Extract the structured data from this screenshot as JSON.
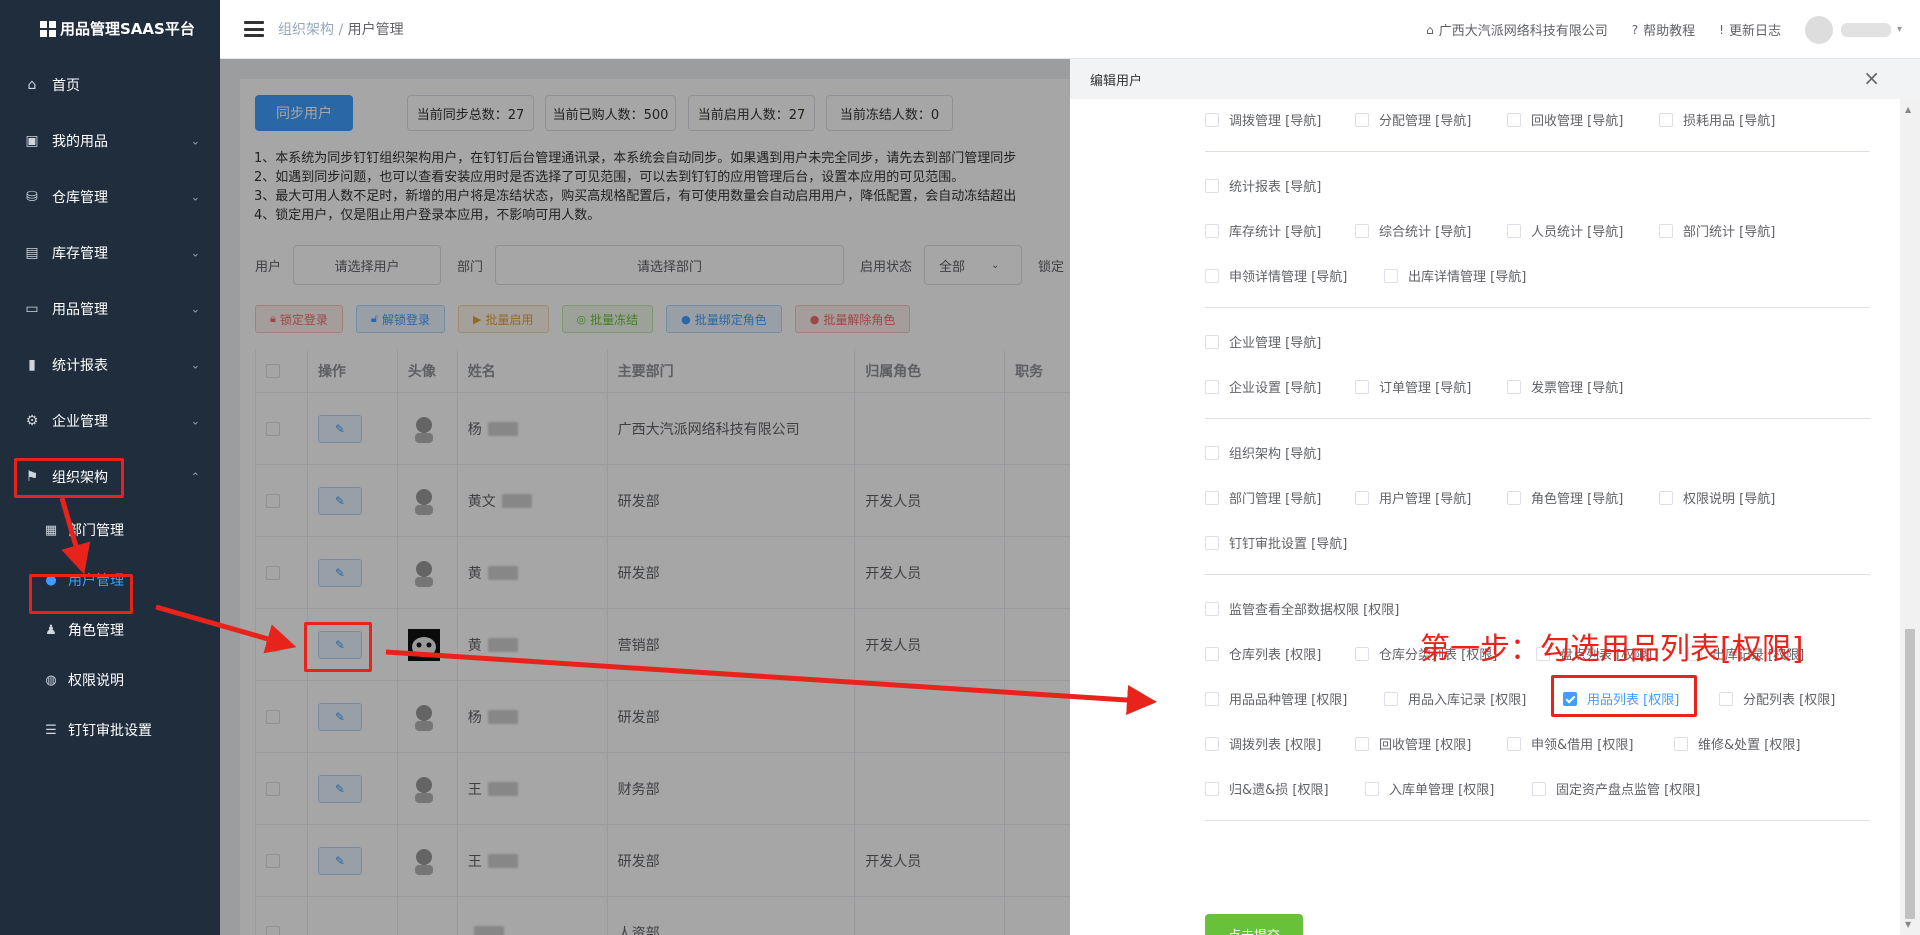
{
  "brand": {
    "title": "用品管理SAAS平台"
  },
  "sidebar": {
    "items": [
      {
        "label": "首页",
        "icon": "home-icon"
      },
      {
        "label": "我的用品",
        "icon": "bag-icon"
      },
      {
        "label": "仓库管理",
        "icon": "database-icon"
      },
      {
        "label": "库存管理",
        "icon": "box-icon"
      },
      {
        "label": "用品管理",
        "icon": "tray-icon"
      },
      {
        "label": "统计报表",
        "icon": "chart-icon"
      },
      {
        "label": "企业管理",
        "icon": "gear-icon"
      },
      {
        "label": "组织架构",
        "icon": "flag-icon"
      }
    ],
    "subitems": [
      {
        "label": "部门管理",
        "icon": "grid-icon"
      },
      {
        "label": "用户管理",
        "icon": "user-icon"
      },
      {
        "label": "角色管理",
        "icon": "role-icon"
      },
      {
        "label": "权限说明",
        "icon": "shield-icon"
      },
      {
        "label": "钉钉审批设置",
        "icon": "sliders-icon"
      }
    ]
  },
  "header": {
    "breadcrumb_parent": "组织架构",
    "breadcrumb_sep": "/",
    "breadcrumb_current": "用户管理",
    "company": "广西大汽派网络科技有限公司",
    "help": "帮助教程",
    "changelog": "更新日志"
  },
  "main": {
    "sync_button": "同步用户",
    "stats": [
      "当前同步总数：27",
      "当前已购人数：500",
      "当前启用人数：27",
      "当前冻结人数：0"
    ],
    "notes": [
      "1、本系统为同步钉钉组织架构用户，在钉钉后台管理通讯录，本系统会自动同步。如果遇到用户未完全同步，请先去到部门管理同步",
      "2、如遇到同步问题，也可以查看安装应用时是否选择了可见范围，可以去到钉钉的应用管理后台，设置本应用的可见范围。",
      "3、最大可用人数不足时，新增的用户将是冻结状态，购买高规格配置后，有可使用数量会自动启用用户，降低配置，会自动冻结超出",
      "4、锁定用户，仅是阻止用户登录本应用，不影响可用人数。"
    ],
    "filter": {
      "user_label": "用户",
      "user_placeholder": "请选择用户",
      "dept_label": "部门",
      "dept_placeholder": "请选择部门",
      "status_label": "启用状态",
      "status_value": "全部",
      "lock_label": "锁定"
    },
    "toolbar": [
      "锁定登录",
      "解锁登录",
      "批量启用",
      "批量冻结",
      "批量绑定角色",
      "批量解除角色"
    ],
    "table": {
      "columns": [
        "操作",
        "头像",
        "姓名",
        "主要部门",
        "归属角色",
        "职务"
      ],
      "rows": [
        {
          "name": "杨",
          "dept": "广西大汽派网络科技有限公司",
          "role": ""
        },
        {
          "name": "黄文",
          "dept": "研发部",
          "role": "开发人员"
        },
        {
          "name": "黄",
          "dept": "研发部",
          "role": "开发人员"
        },
        {
          "name": "黄",
          "dept": "营销部",
          "role": "开发人员"
        },
        {
          "name": "杨",
          "dept": "研发部",
          "role": ""
        },
        {
          "name": "王",
          "dept": "财务部",
          "role": ""
        },
        {
          "name": "王",
          "dept": "研发部",
          "role": "开发人员"
        },
        {
          "name": "",
          "dept": "人资部",
          "role": ""
        }
      ]
    }
  },
  "drawer": {
    "title": "编辑用户",
    "close": "×",
    "perms": [
      "调拨管理 [导航]",
      "分配管理 [导航]",
      "回收管理 [导航]",
      "损耗用品 [导航]",
      "统计报表 [导航]",
      "库存统计 [导航]",
      "综合统计 [导航]",
      "人员统计 [导航]",
      "部门统计 [导航]",
      "申领详情管理 [导航]",
      "出库详情管理 [导航]",
      "企业管理 [导航]",
      "企业设置 [导航]",
      "订单管理 [导航]",
      "发票管理 [导航]",
      "组织架构 [导航]",
      "部门管理 [导航]",
      "用户管理 [导航]",
      "角色管理 [导航]",
      "权限说明 [导航]",
      "钉钉审批设置 [导航]",
      "监管查看全部数据权限 [权限]",
      "仓库列表 [权限]",
      "仓库分类列表 [权限]",
      "盘点列表 [权限]",
      "出库记录 [权限]",
      "用品品种管理 [权限]",
      "用品入库记录 [权限]",
      "用品列表 [权限]",
      "分配列表 [权限]",
      "调拨列表 [权限]",
      "回收管理 [权限]",
      "申领&借用 [权限]",
      "维修&处置 [权限]",
      "归&遗&损 [权限]",
      "入库单管理 [权限]",
      "固定资产盘点监管 [权限]"
    ],
    "step_text": "第一步：勾选用品列表[权限]",
    "submit": "点击提交"
  },
  "colors": {
    "primary": "#409eff",
    "sidebar_bg": "#1f2d3d",
    "annotation_red": "#e8231b",
    "submit_green": "#67c23a"
  }
}
